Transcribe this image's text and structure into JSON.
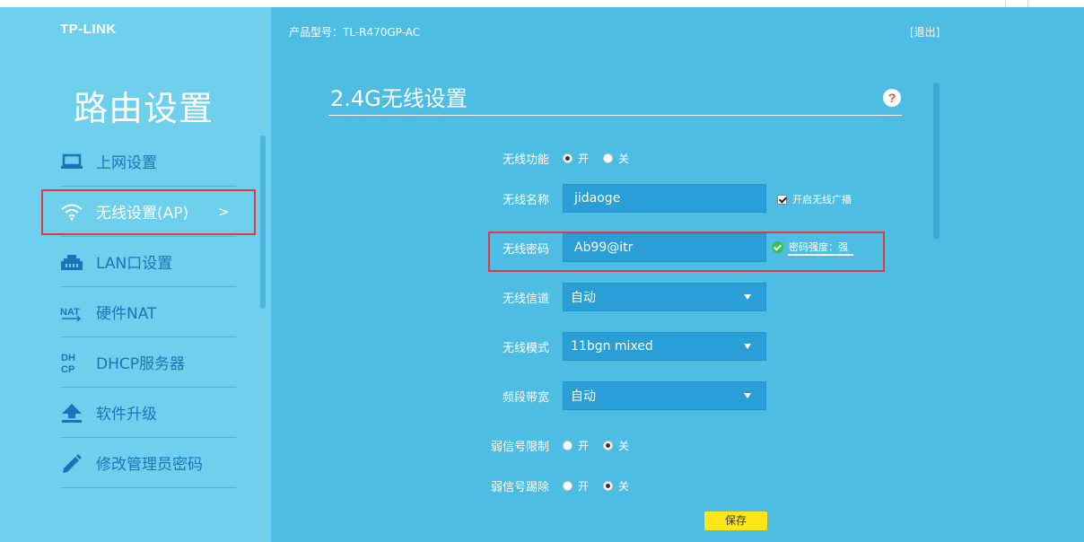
{
  "brand": "TP-LINK",
  "sidebar": {
    "title": "路由设置",
    "items": [
      {
        "label": "上网设置",
        "icon": "laptop-icon"
      },
      {
        "label": "无线设置(AP)",
        "icon": "wifi-icon",
        "active": true
      },
      {
        "label": "LAN口设置",
        "icon": "lan-port-icon"
      },
      {
        "label": "硬件NAT",
        "icon": "nat-icon"
      },
      {
        "label": "DHCP服务器",
        "icon": "dhcp-icon"
      },
      {
        "label": "软件升级",
        "icon": "upload-arrow-icon"
      },
      {
        "label": "修改管理员密码",
        "icon": "pencil-icon"
      }
    ],
    "active_arrow": ">"
  },
  "header": {
    "model": "产品型号：TL-R470GP-AC",
    "logout": "[退出]"
  },
  "section": {
    "title": "2.4G无线设置",
    "help": "?"
  },
  "form": {
    "wireless_func": {
      "label": "无线功能",
      "options": [
        "开",
        "关"
      ],
      "selected": "开"
    },
    "ssid": {
      "label": "无线名称",
      "value": "jidaoge"
    },
    "broadcast": {
      "label": "开启无线广播",
      "checked": true
    },
    "password": {
      "label": "无线密码",
      "value": "Ab99@itr"
    },
    "strength": {
      "text": "密码强度：强"
    },
    "channel": {
      "label": "无线信道",
      "value": "自动"
    },
    "mode": {
      "label": "无线模式",
      "value": "11bgn mixed"
    },
    "bandwidth": {
      "label": "频段带宽",
      "value": "自动"
    },
    "weak_limit": {
      "label": "弱信号限制",
      "options": [
        "开",
        "关"
      ],
      "selected": "关"
    },
    "weak_kick": {
      "label": "弱信号踢除",
      "options": [
        "开",
        "关"
      ],
      "selected": "关"
    },
    "save": "保存"
  },
  "colors": {
    "sidebar_bg": "#6fd0ee",
    "main_bg": "#4dbde3",
    "field_bg": "#2a9ed6",
    "highlight": "#e0393e",
    "save_bg": "#ffe619"
  }
}
